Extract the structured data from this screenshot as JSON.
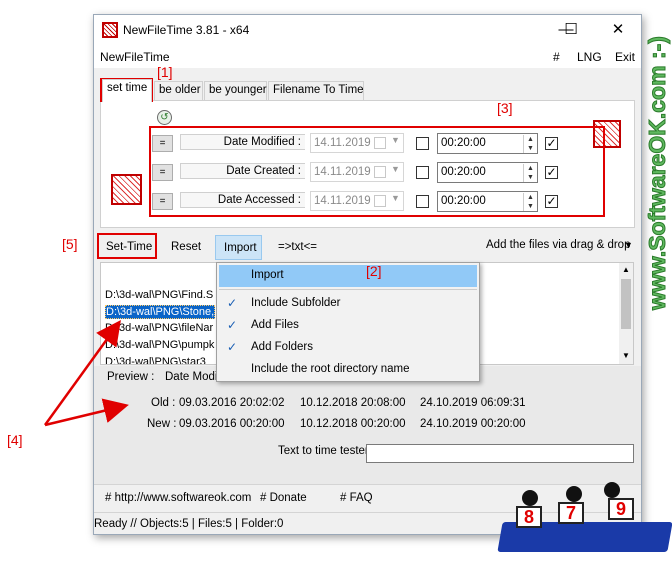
{
  "window": {
    "title": "NewFileTime 3.81 - x64",
    "controls": {
      "minimize": "—",
      "maximize": "☐",
      "close": "✕"
    }
  },
  "menu": {
    "left": "NewFileTime",
    "hash": "#",
    "lng": "LNG",
    "exit": "Exit"
  },
  "tabs": [
    "set time",
    "be older",
    "be younger",
    "Filename To Time"
  ],
  "dates": [
    {
      "eq": "=",
      "label": "Date Modified :",
      "date": "14.11.2019",
      "time": "00:20:00",
      "checked": true
    },
    {
      "eq": "=",
      "label": "Date Created :",
      "date": "14.11.2019",
      "time": "00:20:00",
      "checked": true
    },
    {
      "eq": "=",
      "label": "Date Accessed :",
      "date": "14.11.2019",
      "time": "00:20:00",
      "checked": true
    }
  ],
  "toolbar": {
    "set_time": "Set-Time",
    "reset": "Reset",
    "import": "Import",
    "txt": "=>txt<=",
    "add_files": "Add the files via drag & drop"
  },
  "files": [
    "D:\\3d-wal\\PNG\\Find.S",
    "D:\\3d-wal\\PNG\\Stone,",
    "D:\\3d-wal\\PNG\\fileNar",
    "D:\\3d-wal\\PNG\\pumpk",
    "D:\\3d-wal\\PNG\\star3"
  ],
  "dropdown": {
    "items": [
      {
        "label": "Import",
        "checked": false
      },
      {
        "label": "Include Subfolder",
        "checked": true
      },
      {
        "label": "Add Files",
        "checked": true
      },
      {
        "label": "Add Folders",
        "checked": true
      },
      {
        "label": "Include the root directory name",
        "checked": false
      }
    ]
  },
  "preview": {
    "label": "Preview  :",
    "column": "Date Modifi",
    "old_label": "Old :",
    "new_label": "New :",
    "old": [
      "09.03.2016 20:02:02",
      "10.12.2018 20:08:00",
      "24.10.2019 06:09:31"
    ],
    "new": [
      "09.03.2016 00:20:00",
      "10.12.2018 00:20:00",
      "24.10.2019 00:20:00"
    ]
  },
  "tester": {
    "label": "Text to time tester",
    "value": ""
  },
  "links": [
    "# http://www.softwareok.com",
    "# Donate",
    "# FAQ"
  ],
  "status": "Ready // Objects:5 | Files:5 | Folder:0",
  "annotations": {
    "l1": "[1]",
    "l2": "[2]",
    "l3": "[3]",
    "l4": "[4]",
    "l5": "[5]"
  },
  "watermark": "www.SoftwareOK.com :-)",
  "mascots": [
    "8",
    "7",
    "9"
  ],
  "colors": {
    "annotation": "#e00000",
    "selection": "#0a64c8",
    "menu_highlight": "#91c9f7",
    "watermark": "#5fb85f"
  }
}
